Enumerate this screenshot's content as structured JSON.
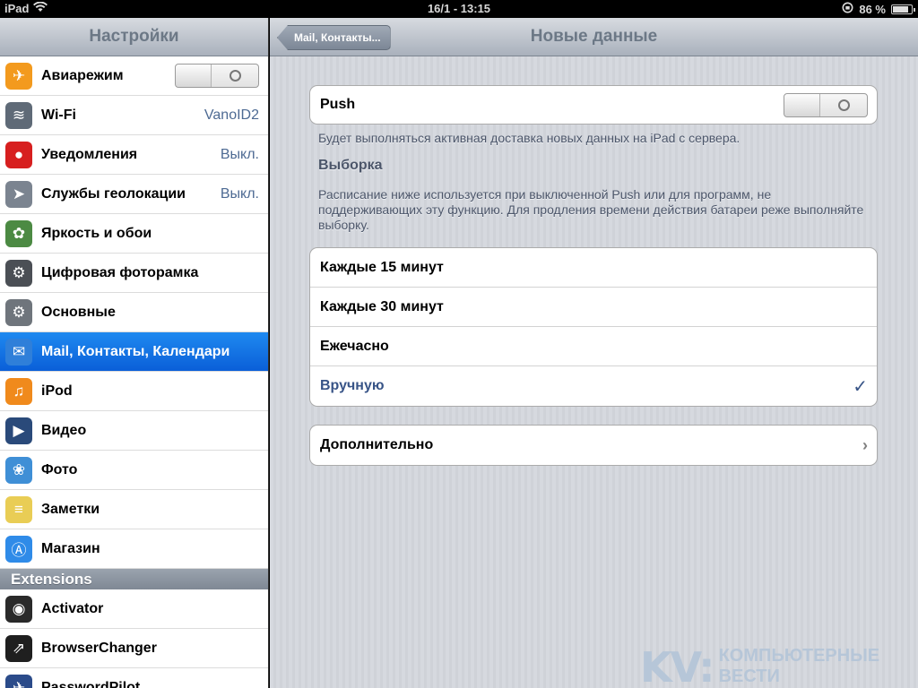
{
  "status": {
    "device": "iPad",
    "time": "16/1 - 13:15",
    "battery": "86 %",
    "battery_level": 0.86
  },
  "sidebar": {
    "title": "Настройки",
    "items": [
      {
        "label": "Авиарежим",
        "value": "",
        "icon": "airplane-icon",
        "color": "#f39a1e",
        "glyph": "✈",
        "toggle": true
      },
      {
        "label": "Wi-Fi",
        "value": "VanoID2",
        "icon": "wifi-icon",
        "color": "#5f6a77",
        "glyph": "≋"
      },
      {
        "label": "Уведомления",
        "value": "Выкл.",
        "icon": "notifications-icon",
        "color": "#d71f1f",
        "glyph": "●"
      },
      {
        "label": "Службы геолокации",
        "value": "Выкл.",
        "icon": "location-icon",
        "color": "#7b8490",
        "glyph": "➤"
      },
      {
        "label": "Яркость и обои",
        "value": "",
        "icon": "brightness-wallpaper-icon",
        "color": "#4c8a43",
        "glyph": "✿"
      },
      {
        "label": "Цифровая фоторамка",
        "value": "",
        "icon": "picture-frame-icon",
        "color": "#4b4f55",
        "glyph": "⚙"
      },
      {
        "label": "Основные",
        "value": "",
        "icon": "gear-icon",
        "color": "#6f757c",
        "glyph": "⚙"
      },
      {
        "label": "Mail, Контакты, Календари",
        "value": "",
        "icon": "mail-icon",
        "color": "#2f7fd9",
        "glyph": "✉",
        "selected": true
      },
      {
        "label": "iPod",
        "value": "",
        "icon": "ipod-icon",
        "color": "#f08a1c",
        "glyph": "♫"
      },
      {
        "label": "Видео",
        "value": "",
        "icon": "video-icon",
        "color": "#2a4a7a",
        "glyph": "▶"
      },
      {
        "label": "Фото",
        "value": "",
        "icon": "photos-icon",
        "color": "#3f8fd6",
        "glyph": "❀"
      },
      {
        "label": "Заметки",
        "value": "",
        "icon": "notes-icon",
        "color": "#e9cd55",
        "glyph": "≡"
      },
      {
        "label": "Магазин",
        "value": "",
        "icon": "store-icon",
        "color": "#2f8be8",
        "glyph": "Ⓐ"
      }
    ],
    "extensions_title": "Extensions",
    "extensions": [
      {
        "label": "Activator",
        "icon": "activator-icon",
        "color": "#2a2a2a",
        "glyph": "◉"
      },
      {
        "label": "BrowserChanger",
        "icon": "browserchanger-icon",
        "color": "#1f1f1f",
        "glyph": "⇗"
      },
      {
        "label": "PasswordPilot",
        "icon": "passwordpilot-icon",
        "color": "#2b4b8a",
        "glyph": "✈"
      }
    ]
  },
  "main": {
    "title": "Новые данные",
    "back_label": "Mail, Контакты...",
    "push_label": "Push",
    "push_note": "Будет выполняться активная доставка новых данных на iPad с сервера.",
    "fetch_heading": "Выборка",
    "fetch_note": "Расписание ниже используется при выключенной Push или для программ, не поддерживающих эту функцию. Для продления времени действия батареи реже выполняйте выборку.",
    "options": [
      {
        "label": "Каждые 15 минут",
        "checked": false
      },
      {
        "label": "Каждые 30 минут",
        "checked": false
      },
      {
        "label": "Ежечасно",
        "checked": false
      },
      {
        "label": "Вручную",
        "checked": true
      }
    ],
    "advanced_label": "Дополнительно"
  },
  "watermark": {
    "logo": "KV:",
    "line1": "КОМПЬЮТЕРНЫЕ",
    "line2": "ВЕСТИ"
  }
}
